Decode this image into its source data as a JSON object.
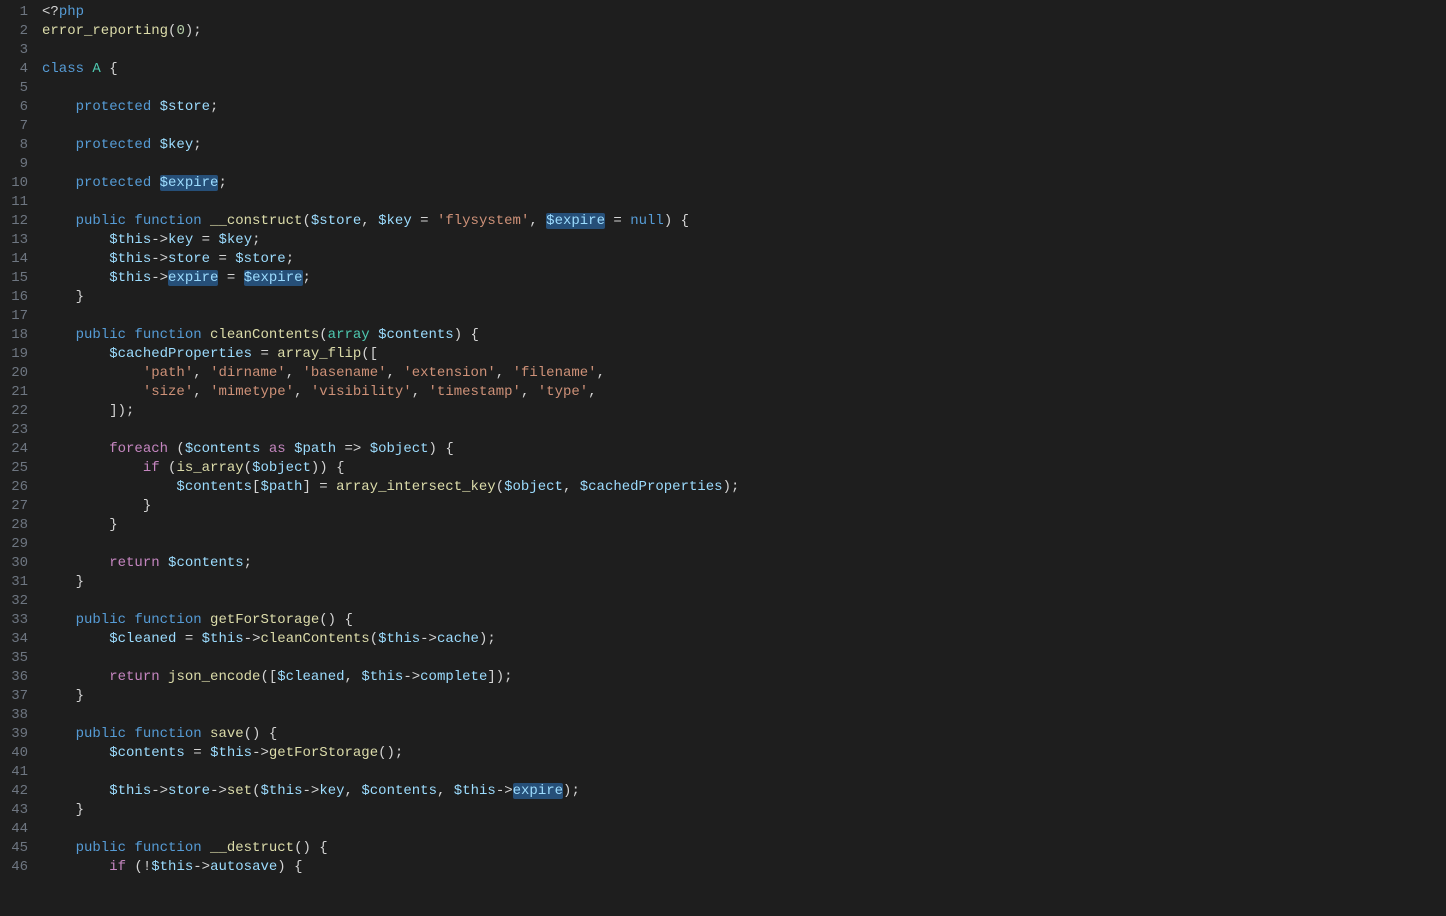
{
  "editor": {
    "lines": [
      {
        "n": 1,
        "tokens": [
          [
            "p",
            "<?"
          ],
          [
            "k",
            "php"
          ]
        ]
      },
      {
        "n": 2,
        "tokens": [
          [
            "fn",
            "error_reporting"
          ],
          [
            "p",
            "("
          ],
          [
            "n",
            "0"
          ],
          [
            "p",
            ");"
          ]
        ]
      },
      {
        "n": 3,
        "tokens": []
      },
      {
        "n": 4,
        "tokens": [
          [
            "k",
            "class"
          ],
          [
            "p",
            " "
          ],
          [
            "t",
            "A"
          ],
          [
            "p",
            " {"
          ]
        ]
      },
      {
        "n": 5,
        "tokens": [],
        "indent": 1
      },
      {
        "n": 6,
        "tokens": [
          [
            "k",
            "    protected"
          ],
          [
            "p",
            " "
          ],
          [
            "v",
            "$store"
          ],
          [
            "p",
            ";"
          ]
        ],
        "indent": 1
      },
      {
        "n": 7,
        "tokens": [],
        "indent": 1
      },
      {
        "n": 8,
        "tokens": [
          [
            "k",
            "    protected"
          ],
          [
            "p",
            " "
          ],
          [
            "v",
            "$key"
          ],
          [
            "p",
            ";"
          ]
        ],
        "indent": 1
      },
      {
        "n": 9,
        "tokens": [],
        "indent": 1
      },
      {
        "n": 10,
        "tokens": [
          [
            "k",
            "    protected"
          ],
          [
            "p",
            " "
          ],
          [
            "v",
            "$expire",
            "hl"
          ],
          [
            "p",
            ";"
          ]
        ],
        "indent": 1
      },
      {
        "n": 11,
        "tokens": [],
        "indent": 1
      },
      {
        "n": 12,
        "tokens": [
          [
            "k",
            "    public"
          ],
          [
            "p",
            " "
          ],
          [
            "k",
            "function"
          ],
          [
            "p",
            " "
          ],
          [
            "fn",
            "__construct"
          ],
          [
            "p",
            "("
          ],
          [
            "v",
            "$store"
          ],
          [
            "p",
            ", "
          ],
          [
            "v",
            "$key"
          ],
          [
            "p",
            " = "
          ],
          [
            "s",
            "'flysystem'"
          ],
          [
            "p",
            ", "
          ],
          [
            "v",
            "$expire",
            "hl"
          ],
          [
            "p",
            " = "
          ],
          [
            "k",
            "null"
          ],
          [
            "p",
            ") {"
          ]
        ],
        "indent": 1
      },
      {
        "n": 13,
        "tokens": [
          [
            "p",
            "        "
          ],
          [
            "v",
            "$this"
          ],
          [
            "p",
            "->"
          ],
          [
            "v",
            "key"
          ],
          [
            "p",
            " = "
          ],
          [
            "v",
            "$key"
          ],
          [
            "p",
            ";"
          ]
        ],
        "indent": 2
      },
      {
        "n": 14,
        "tokens": [
          [
            "p",
            "        "
          ],
          [
            "v",
            "$this"
          ],
          [
            "p",
            "->"
          ],
          [
            "v",
            "store"
          ],
          [
            "p",
            " = "
          ],
          [
            "v",
            "$store"
          ],
          [
            "p",
            ";"
          ]
        ],
        "indent": 2
      },
      {
        "n": 15,
        "tokens": [
          [
            "p",
            "        "
          ],
          [
            "v",
            "$this"
          ],
          [
            "p",
            "->"
          ],
          [
            "v",
            "expire",
            "hl"
          ],
          [
            "p",
            " = "
          ],
          [
            "v",
            "$expire",
            "hl"
          ],
          [
            "p",
            ";"
          ]
        ],
        "indent": 2
      },
      {
        "n": 16,
        "tokens": [
          [
            "p",
            "    }"
          ]
        ],
        "indent": 1
      },
      {
        "n": 17,
        "tokens": [],
        "indent": 1
      },
      {
        "n": 18,
        "tokens": [
          [
            "k",
            "    public"
          ],
          [
            "p",
            " "
          ],
          [
            "k",
            "function"
          ],
          [
            "p",
            " "
          ],
          [
            "fn",
            "cleanContents"
          ],
          [
            "p",
            "("
          ],
          [
            "t",
            "array"
          ],
          [
            "p",
            " "
          ],
          [
            "v",
            "$contents"
          ],
          [
            "p",
            ") {"
          ]
        ],
        "indent": 1
      },
      {
        "n": 19,
        "tokens": [
          [
            "p",
            "        "
          ],
          [
            "v",
            "$cachedProperties"
          ],
          [
            "p",
            " = "
          ],
          [
            "fn",
            "array_flip"
          ],
          [
            "p",
            "(["
          ]
        ],
        "indent": 2
      },
      {
        "n": 20,
        "tokens": [
          [
            "p",
            "            "
          ],
          [
            "s",
            "'path'"
          ],
          [
            "p",
            ", "
          ],
          [
            "s",
            "'dirname'"
          ],
          [
            "p",
            ", "
          ],
          [
            "s",
            "'basename'"
          ],
          [
            "p",
            ", "
          ],
          [
            "s",
            "'extension'"
          ],
          [
            "p",
            ", "
          ],
          [
            "s",
            "'filename'"
          ],
          [
            "p",
            ","
          ]
        ],
        "indent": 3
      },
      {
        "n": 21,
        "tokens": [
          [
            "p",
            "            "
          ],
          [
            "s",
            "'size'"
          ],
          [
            "p",
            ", "
          ],
          [
            "s",
            "'mimetype'"
          ],
          [
            "p",
            ", "
          ],
          [
            "s",
            "'visibility'"
          ],
          [
            "p",
            ", "
          ],
          [
            "s",
            "'timestamp'"
          ],
          [
            "p",
            ", "
          ],
          [
            "s",
            "'type'"
          ],
          [
            "p",
            ","
          ]
        ],
        "indent": 3
      },
      {
        "n": 22,
        "tokens": [
          [
            "p",
            "        ]);"
          ]
        ],
        "indent": 2
      },
      {
        "n": 23,
        "tokens": [],
        "indent": 2
      },
      {
        "n": 24,
        "tokens": [
          [
            "p",
            "        "
          ],
          [
            "kw",
            "foreach"
          ],
          [
            "p",
            " ("
          ],
          [
            "v",
            "$contents"
          ],
          [
            "p",
            " "
          ],
          [
            "kw",
            "as"
          ],
          [
            "p",
            " "
          ],
          [
            "v",
            "$path"
          ],
          [
            "p",
            " => "
          ],
          [
            "v",
            "$object"
          ],
          [
            "p",
            ") {"
          ]
        ],
        "indent": 2
      },
      {
        "n": 25,
        "tokens": [
          [
            "p",
            "            "
          ],
          [
            "kw",
            "if"
          ],
          [
            "p",
            " ("
          ],
          [
            "fn",
            "is_array"
          ],
          [
            "p",
            "("
          ],
          [
            "v",
            "$object"
          ],
          [
            "p",
            ")) {"
          ]
        ],
        "indent": 3
      },
      {
        "n": 26,
        "tokens": [
          [
            "p",
            "                "
          ],
          [
            "v",
            "$contents"
          ],
          [
            "p",
            "["
          ],
          [
            "v",
            "$path"
          ],
          [
            "p",
            "] = "
          ],
          [
            "fn",
            "array_intersect_key"
          ],
          [
            "p",
            "("
          ],
          [
            "v",
            "$object"
          ],
          [
            "p",
            ", "
          ],
          [
            "v",
            "$cachedProperties"
          ],
          [
            "p",
            ");"
          ]
        ],
        "indent": 4
      },
      {
        "n": 27,
        "tokens": [
          [
            "p",
            "            }"
          ]
        ],
        "indent": 3
      },
      {
        "n": 28,
        "tokens": [
          [
            "p",
            "        }"
          ]
        ],
        "indent": 2
      },
      {
        "n": 29,
        "tokens": [],
        "indent": 2
      },
      {
        "n": 30,
        "tokens": [
          [
            "p",
            "        "
          ],
          [
            "kw",
            "return"
          ],
          [
            "p",
            " "
          ],
          [
            "v",
            "$contents"
          ],
          [
            "p",
            ";"
          ]
        ],
        "indent": 2
      },
      {
        "n": 31,
        "tokens": [
          [
            "p",
            "    }"
          ]
        ],
        "indent": 1
      },
      {
        "n": 32,
        "tokens": [],
        "indent": 1
      },
      {
        "n": 33,
        "tokens": [
          [
            "k",
            "    public"
          ],
          [
            "p",
            " "
          ],
          [
            "k",
            "function"
          ],
          [
            "p",
            " "
          ],
          [
            "fn",
            "getForStorage"
          ],
          [
            "p",
            "() {"
          ]
        ],
        "indent": 1
      },
      {
        "n": 34,
        "tokens": [
          [
            "p",
            "        "
          ],
          [
            "v",
            "$cleaned"
          ],
          [
            "p",
            " = "
          ],
          [
            "v",
            "$this"
          ],
          [
            "p",
            "->"
          ],
          [
            "fn",
            "cleanContents"
          ],
          [
            "p",
            "("
          ],
          [
            "v",
            "$this"
          ],
          [
            "p",
            "->"
          ],
          [
            "v",
            "cache"
          ],
          [
            "p",
            ");"
          ]
        ],
        "indent": 2
      },
      {
        "n": 35,
        "tokens": [],
        "indent": 2
      },
      {
        "n": 36,
        "tokens": [
          [
            "p",
            "        "
          ],
          [
            "kw",
            "return"
          ],
          [
            "p",
            " "
          ],
          [
            "fn",
            "json_encode"
          ],
          [
            "p",
            "(["
          ],
          [
            "v",
            "$cleaned"
          ],
          [
            "p",
            ", "
          ],
          [
            "v",
            "$this"
          ],
          [
            "p",
            "->"
          ],
          [
            "v",
            "complete"
          ],
          [
            "p",
            "]);"
          ]
        ],
        "indent": 2
      },
      {
        "n": 37,
        "tokens": [
          [
            "p",
            "    }"
          ]
        ],
        "indent": 1
      },
      {
        "n": 38,
        "tokens": [],
        "indent": 1
      },
      {
        "n": 39,
        "tokens": [
          [
            "k",
            "    public"
          ],
          [
            "p",
            " "
          ],
          [
            "k",
            "function"
          ],
          [
            "p",
            " "
          ],
          [
            "fn",
            "save"
          ],
          [
            "p",
            "() {"
          ]
        ],
        "indent": 1
      },
      {
        "n": 40,
        "tokens": [
          [
            "p",
            "        "
          ],
          [
            "v",
            "$contents"
          ],
          [
            "p",
            " = "
          ],
          [
            "v",
            "$this"
          ],
          [
            "p",
            "->"
          ],
          [
            "fn",
            "getForStorage"
          ],
          [
            "p",
            "();"
          ]
        ],
        "indent": 2
      },
      {
        "n": 41,
        "tokens": [],
        "indent": 2
      },
      {
        "n": 42,
        "tokens": [
          [
            "p",
            "        "
          ],
          [
            "v",
            "$this"
          ],
          [
            "p",
            "->"
          ],
          [
            "v",
            "store"
          ],
          [
            "p",
            "->"
          ],
          [
            "fn",
            "set"
          ],
          [
            "p",
            "("
          ],
          [
            "v",
            "$this"
          ],
          [
            "p",
            "->"
          ],
          [
            "v",
            "key"
          ],
          [
            "p",
            ", "
          ],
          [
            "v",
            "$contents"
          ],
          [
            "p",
            ", "
          ],
          [
            "v",
            "$this"
          ],
          [
            "p",
            "->"
          ],
          [
            "v",
            "expire",
            "hl"
          ],
          [
            "p",
            ");"
          ]
        ],
        "indent": 2
      },
      {
        "n": 43,
        "tokens": [
          [
            "p",
            "    }"
          ]
        ],
        "indent": 1
      },
      {
        "n": 44,
        "tokens": [],
        "indent": 1
      },
      {
        "n": 45,
        "tokens": [
          [
            "k",
            "    public"
          ],
          [
            "p",
            " "
          ],
          [
            "k",
            "function"
          ],
          [
            "p",
            " "
          ],
          [
            "fn",
            "__destruct"
          ],
          [
            "p",
            "() {"
          ]
        ],
        "indent": 1
      },
      {
        "n": 46,
        "tokens": [
          [
            "p",
            "        "
          ],
          [
            "kw",
            "if"
          ],
          [
            "p",
            " (!"
          ],
          [
            "v",
            "$this"
          ],
          [
            "p",
            "->"
          ],
          [
            "v",
            "autosave"
          ],
          [
            "p",
            ") {"
          ]
        ],
        "indent": 2
      }
    ]
  }
}
